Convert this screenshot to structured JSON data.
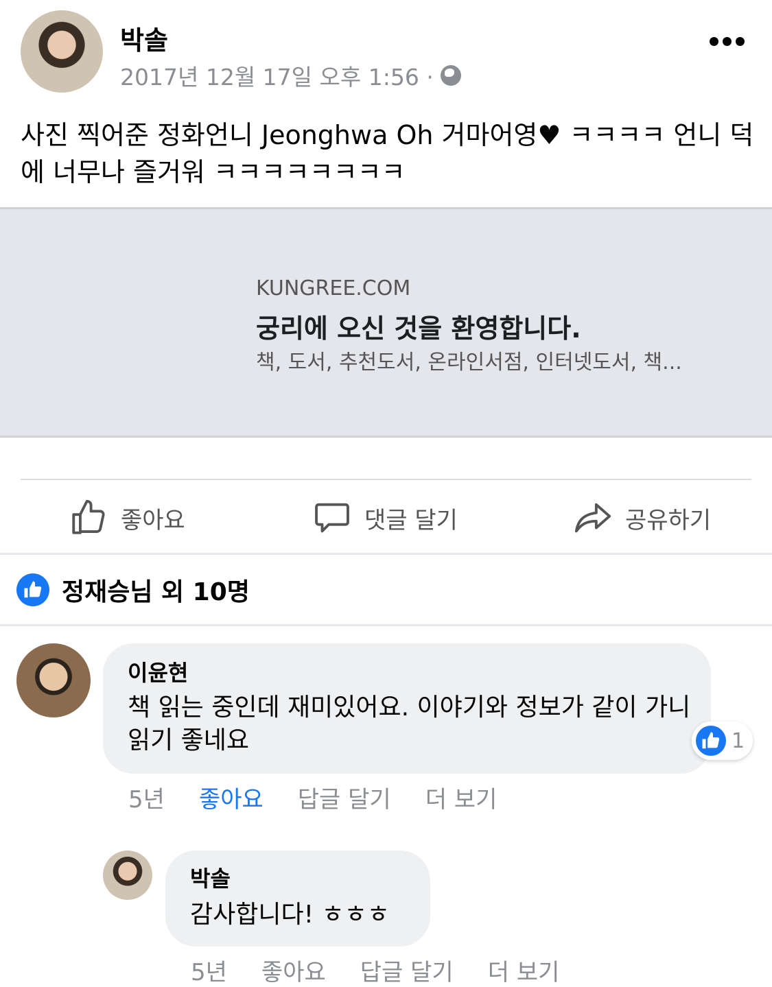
{
  "post": {
    "author": "박솔",
    "date": "2017년 12월 17일 오후 1:56 ·",
    "text": "사진 찍어준 정화언니 Jeonghwa Oh 거마어영♥ ㅋㅋㅋㅋ 언니 덕에 너무나 즐거워 ㅋㅋㅋㅋㅋㅋㅋㅋ"
  },
  "link_card": {
    "domain": "KUNGREE.COM",
    "title": "궁리에 오신 것을 환영합니다.",
    "description": "책, 도서, 추천도서, 온라인서점, 인터넷도서, 책..."
  },
  "actions": {
    "like": "좋아요",
    "comment": "댓글 달기",
    "share": "공유하기"
  },
  "likes_summary": "정재승님 외 10명",
  "comments": [
    {
      "name": "이윤현",
      "text": "책 읽는 중인데 재미있어요. 이야기와 정보가 같이 가니 읽기 좋네요",
      "reaction_count": "1",
      "time": "5년",
      "like": "좋아요",
      "reply": "답글 달기",
      "more": "더 보기"
    },
    {
      "name": "박솔",
      "text": "감사합니다! ㅎㅎㅎ",
      "time": "5년",
      "like": "좋아요",
      "reply": "답글 달기",
      "more": "더 보기"
    }
  ],
  "colors": {
    "accent": "#1877f2",
    "muted": "#8a8d91",
    "card_bg": "#e4e6eb"
  }
}
